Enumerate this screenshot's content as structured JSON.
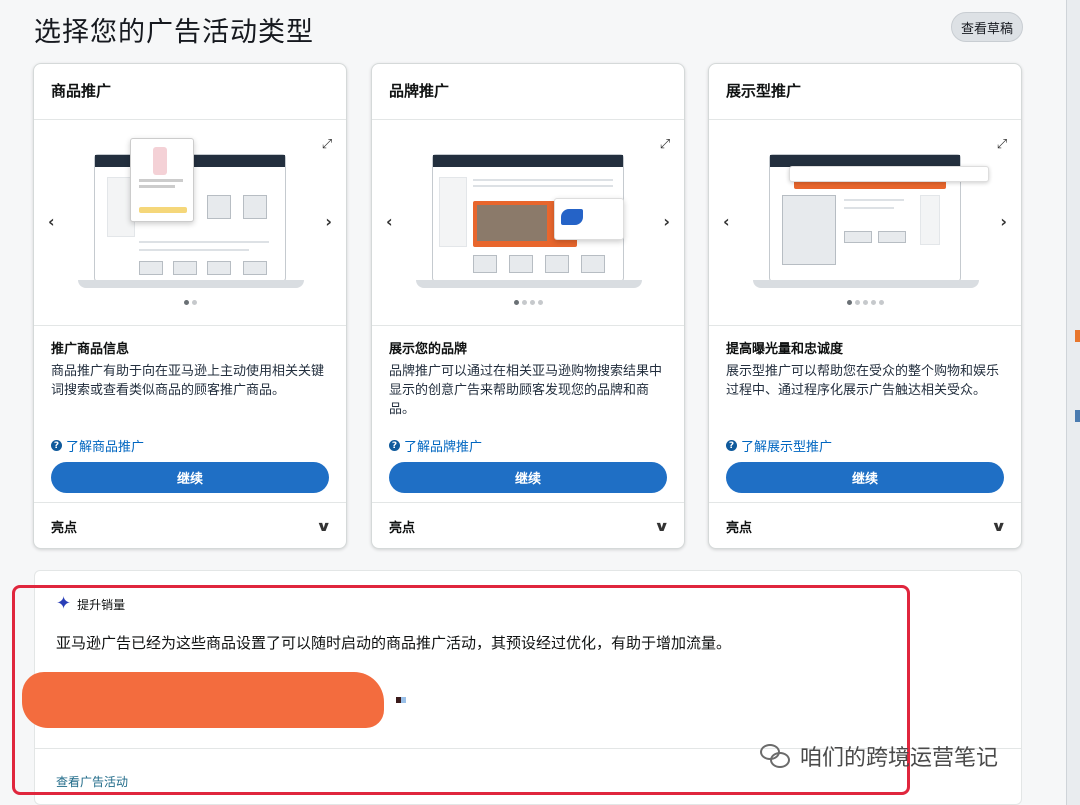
{
  "page": {
    "title": "选择您的广告活动类型",
    "draft_button": "查看草稿"
  },
  "cards": [
    {
      "title": "商品推广",
      "subtitle": "推广商品信息",
      "description": "商品推广有助于向在亚马逊上主动使用相关关键词搜索或查看类似商品的顾客推广商品。",
      "learn_more": "了解商品推广",
      "button": "继续",
      "footer": "亮点",
      "dots": 2
    },
    {
      "title": "品牌推广",
      "subtitle": "展示您的品牌",
      "description": "品牌推广可以通过在相关亚马逊购物搜索结果中显示的创意广告来帮助顾客发现您的品牌和商品。",
      "learn_more": "了解品牌推广",
      "button": "继续",
      "footer": "亮点",
      "dots": 4
    },
    {
      "title": "展示型推广",
      "subtitle": "提高曝光量和忠诚度",
      "description": "展示型推广可以帮助您在受众的整个购物和娱乐过程中、通过程序化展示广告触达相关受众。",
      "learn_more": "了解展示型推广",
      "button": "继续",
      "footer": "亮点",
      "dots": 5
    }
  ],
  "promo": {
    "tag": "提升销量",
    "text": "亚马逊广告已经为这些商品设置了可以随时启动的商品推广活动，其预设经过优化，有助于增加流量。",
    "link": "查看广告活动"
  },
  "watermark": "咱们的跨境运营笔记",
  "colors": {
    "primary_button": "#1f6fc5",
    "link": "#0066c0",
    "highlight_border": "#e0263d",
    "redaction": "#f36c3e"
  }
}
